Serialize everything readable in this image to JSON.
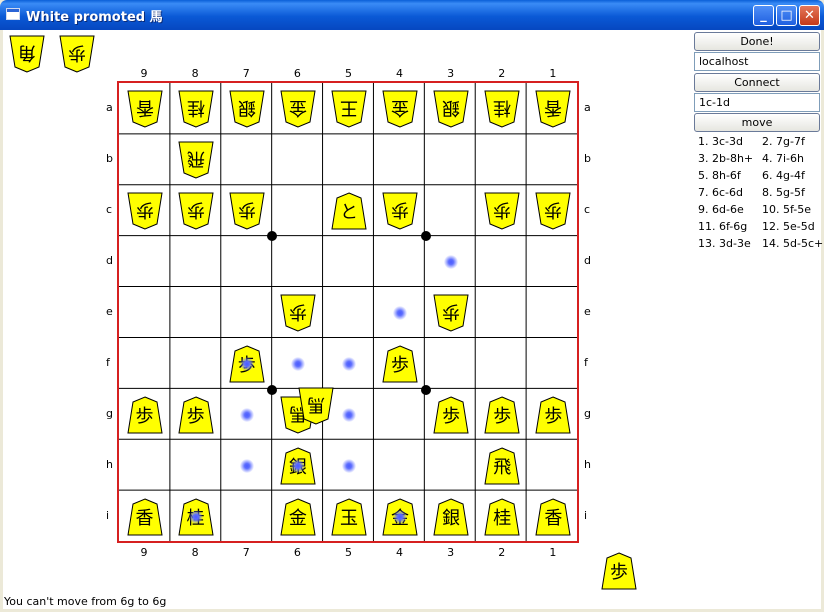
{
  "window": {
    "title": "White promoted 馬"
  },
  "controls": {
    "done_label": "Done!",
    "host_value": "localhost",
    "connect_label": "Connect",
    "move_value": "1c-1d",
    "move_label": "move"
  },
  "move_list": [
    [
      "1. 3c-3d",
      "2. 7g-7f"
    ],
    [
      "3. 2b-8h+",
      "4. 7i-6h"
    ],
    [
      "5. 8h-6f",
      "6. 4g-4f"
    ],
    [
      "7. 6c-6d",
      "8. 5g-5f"
    ],
    [
      "9. 6d-6e",
      "10. 5f-5e"
    ],
    [
      "11. 6f-6g",
      "12. 5e-5d"
    ],
    [
      "13. 3d-3e",
      "14. 5d-5c+"
    ]
  ],
  "status": "You can't move from 6g to 6g",
  "board": {
    "files": [
      "9",
      "8",
      "7",
      "6",
      "5",
      "4",
      "3",
      "2",
      "1"
    ],
    "ranks": [
      "a",
      "b",
      "c",
      "d",
      "e",
      "f",
      "g",
      "h",
      "i"
    ],
    "pieces": [
      {
        "sq": "9a",
        "k": "香",
        "side": "white"
      },
      {
        "sq": "8a",
        "k": "桂",
        "side": "white"
      },
      {
        "sq": "7a",
        "k": "銀",
        "side": "white"
      },
      {
        "sq": "6a",
        "k": "金",
        "side": "white"
      },
      {
        "sq": "5a",
        "k": "王",
        "side": "white"
      },
      {
        "sq": "4a",
        "k": "金",
        "side": "white"
      },
      {
        "sq": "3a",
        "k": "銀",
        "side": "white"
      },
      {
        "sq": "2a",
        "k": "桂",
        "side": "white"
      },
      {
        "sq": "1a",
        "k": "香",
        "side": "white"
      },
      {
        "sq": "8b",
        "k": "飛",
        "side": "white"
      },
      {
        "sq": "9c",
        "k": "歩",
        "side": "white"
      },
      {
        "sq": "8c",
        "k": "歩",
        "side": "white"
      },
      {
        "sq": "7c",
        "k": "歩",
        "side": "white"
      },
      {
        "sq": "5c",
        "k": "と",
        "side": "black"
      },
      {
        "sq": "4c",
        "k": "歩",
        "side": "white"
      },
      {
        "sq": "2c",
        "k": "歩",
        "side": "white"
      },
      {
        "sq": "1c",
        "k": "歩",
        "side": "white"
      },
      {
        "sq": "6e",
        "k": "歩",
        "side": "white"
      },
      {
        "sq": "3e",
        "k": "歩",
        "side": "white"
      },
      {
        "sq": "7f",
        "k": "歩",
        "side": "black"
      },
      {
        "sq": "4f",
        "k": "歩",
        "side": "black"
      },
      {
        "sq": "9g",
        "k": "歩",
        "side": "black"
      },
      {
        "sq": "8g",
        "k": "歩",
        "side": "black"
      },
      {
        "sq": "6g",
        "k": "馬",
        "side": "white"
      },
      {
        "sq": "3g",
        "k": "歩",
        "side": "black"
      },
      {
        "sq": "2g",
        "k": "歩",
        "side": "black"
      },
      {
        "sq": "1g",
        "k": "歩",
        "side": "black"
      },
      {
        "sq": "6h",
        "k": "銀",
        "side": "black"
      },
      {
        "sq": "2h",
        "k": "飛",
        "side": "black"
      },
      {
        "sq": "9i",
        "k": "香",
        "side": "black"
      },
      {
        "sq": "8i",
        "k": "桂",
        "side": "black"
      },
      {
        "sq": "6i",
        "k": "金",
        "side": "black"
      },
      {
        "sq": "5i",
        "k": "玉",
        "side": "black"
      },
      {
        "sq": "4i",
        "k": "金",
        "side": "black"
      },
      {
        "sq": "3i",
        "k": "銀",
        "side": "black"
      },
      {
        "sq": "2i",
        "k": "桂",
        "side": "black"
      },
      {
        "sq": "1i",
        "k": "香",
        "side": "black"
      }
    ],
    "dragging_piece": {
      "k": "馬",
      "side": "white",
      "from": "6g"
    },
    "move_hints": [
      "3d",
      "4e",
      "6f",
      "5f",
      "7g",
      "5g",
      "7h",
      "6h",
      "5h",
      "8i",
      "4i",
      "7f"
    ],
    "star_points": [
      "6c/6d",
      "3c/3d",
      "6f/6g",
      "3f/3g"
    ]
  },
  "hands": {
    "white": [
      {
        "k": "角"
      },
      {
        "k": "歩"
      }
    ],
    "black": [
      {
        "k": "歩"
      }
    ]
  },
  "colors": {
    "piece_fill": "#ffff00",
    "board_border": "#d62020",
    "hint_dot": "#4b5cff"
  }
}
